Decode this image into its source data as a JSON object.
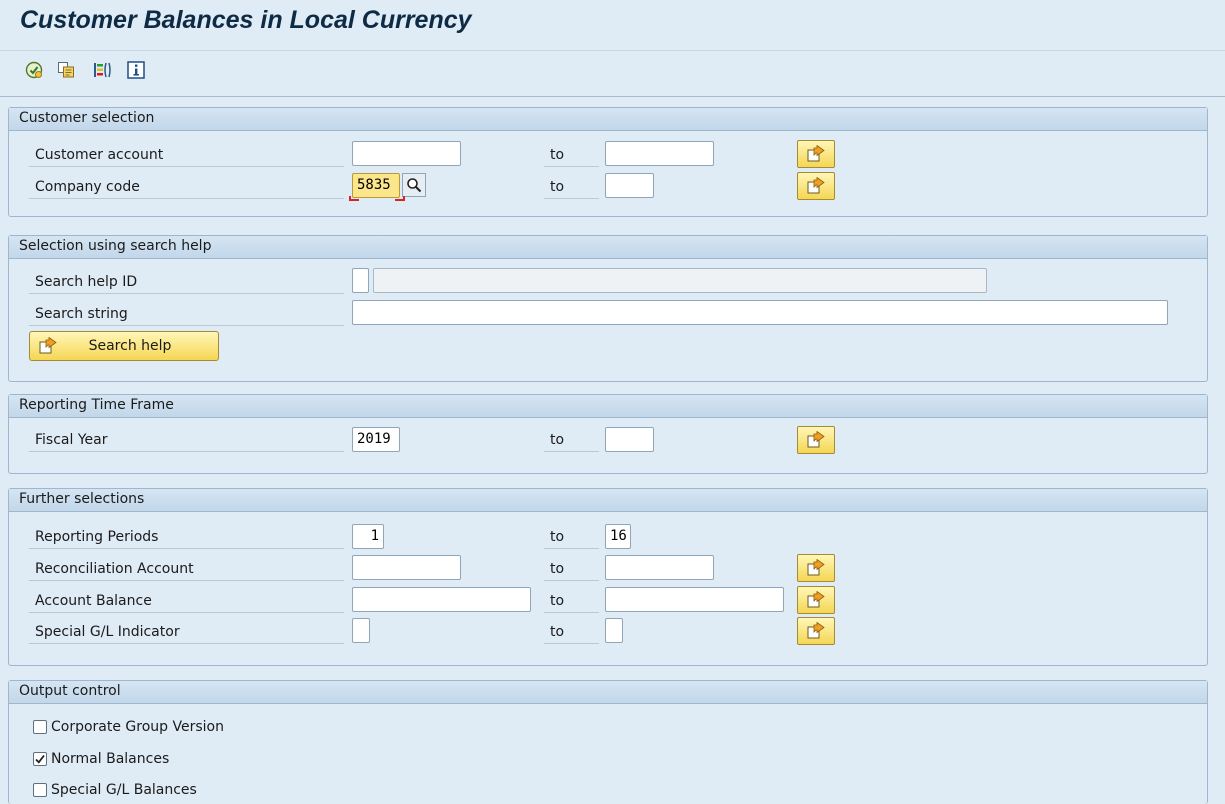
{
  "title": "Customer Balances in Local Currency",
  "toolbar": {
    "icons": [
      "execute-icon",
      "copy-variant-icon",
      "selection-options-icon",
      "information-icon"
    ]
  },
  "customer_selection": {
    "header": "Customer selection",
    "customer_account": {
      "label": "Customer account",
      "from": "",
      "to_label": "to",
      "to": ""
    },
    "company_code": {
      "label": "Company code",
      "from": "5835",
      "to_label": "to",
      "to": ""
    }
  },
  "search_help": {
    "header": "Selection using search help",
    "search_help_id": {
      "label": "Search help ID",
      "value": "",
      "description": ""
    },
    "search_string": {
      "label": "Search string",
      "value": ""
    },
    "button_label": "Search help"
  },
  "reporting_time_frame": {
    "header": "Reporting Time Frame",
    "fiscal_year": {
      "label": "Fiscal Year",
      "from": "2019",
      "to_label": "to",
      "to": ""
    }
  },
  "further_selections": {
    "header": "Further selections",
    "reporting_periods": {
      "label": "Reporting Periods",
      "from": "1",
      "to_label": "to",
      "to": "16"
    },
    "reconciliation_account": {
      "label": "Reconciliation Account",
      "from": "",
      "to_label": "to",
      "to": ""
    },
    "account_balance": {
      "label": "Account Balance",
      "from": "",
      "to_label": "to",
      "to": ""
    },
    "special_gl_indicator": {
      "label": "Special G/L Indicator",
      "from": "",
      "to_label": "to",
      "to": ""
    }
  },
  "output_control": {
    "header": "Output control",
    "options": [
      {
        "label": "Corporate Group Version",
        "checked": false
      },
      {
        "label": "Normal Balances",
        "checked": true
      },
      {
        "label": "Special G/L Balances",
        "checked": false
      }
    ]
  },
  "colors": {
    "background": "#dfebf5",
    "button_yellow": "#f5d653",
    "highlight_field": "#fbe68b",
    "title": "#0e2b45"
  }
}
